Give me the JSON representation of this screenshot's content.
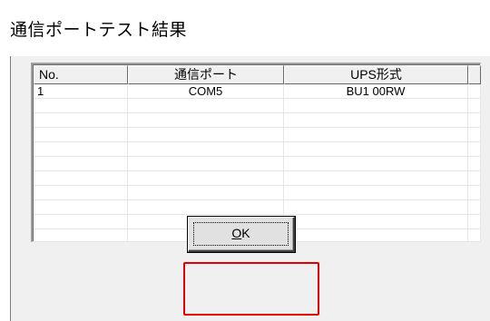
{
  "window": {
    "title": "通信ポートテスト結果"
  },
  "table": {
    "columns": [
      "No.",
      "通信ポート",
      "UPS形式"
    ],
    "rows": [
      [
        "1",
        "COM5",
        "BU1 00RW"
      ],
      [
        "",
        "",
        ""
      ],
      [
        "",
        "",
        ""
      ],
      [
        "",
        "",
        ""
      ],
      [
        "",
        "",
        ""
      ],
      [
        "",
        "",
        ""
      ],
      [
        "",
        "",
        ""
      ],
      [
        "",
        "",
        ""
      ],
      [
        "",
        "",
        ""
      ],
      [
        "",
        "",
        ""
      ],
      [
        "",
        "",
        ""
      ]
    ]
  },
  "buttons": {
    "ok_mnemonic": "O",
    "ok_rest": "K"
  },
  "highlight": {
    "color": "#e30000"
  }
}
